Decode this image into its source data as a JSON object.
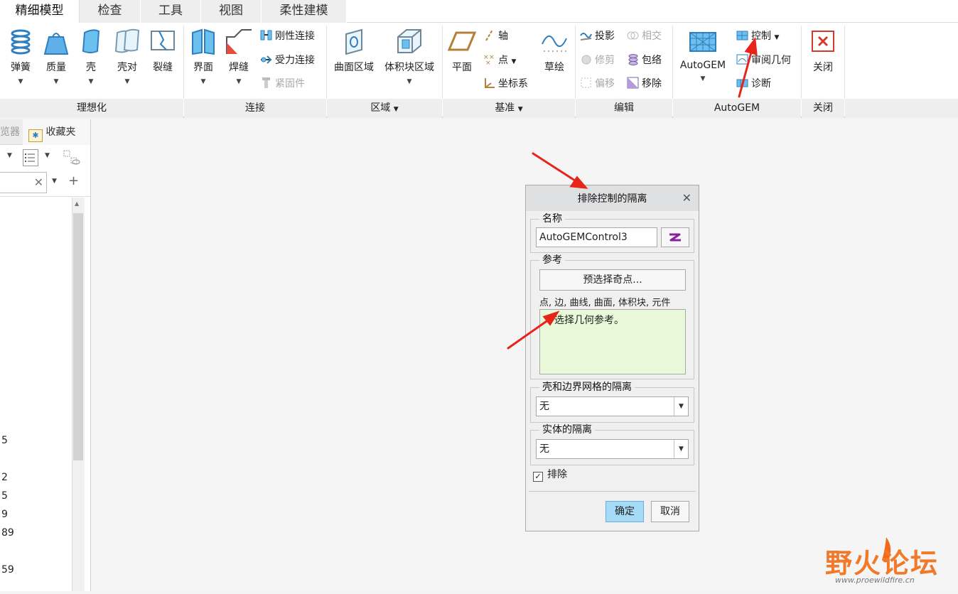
{
  "tabs": [
    "精细模型",
    "检查",
    "工具",
    "视图",
    "柔性建模"
  ],
  "ribbon": {
    "ideal": {
      "group": "理想化",
      "items": [
        "弹簧",
        "质量",
        "壳",
        "壳对",
        "裂缝"
      ]
    },
    "connect": {
      "group": "连接",
      "big": [
        "界面",
        "焊缝"
      ],
      "small": [
        "刚性连接",
        "受力连接",
        "紧固件"
      ]
    },
    "region": {
      "group": "区域",
      "items": [
        "曲面区域",
        "体积块区域"
      ]
    },
    "datum": {
      "group": "基准",
      "plane": "平面",
      "small": [
        "轴",
        "点",
        "坐标系"
      ],
      "sketch": "草绘"
    },
    "edit": {
      "group": "编辑",
      "col1": [
        "投影",
        "修剪",
        "偏移"
      ],
      "col2": [
        "相交",
        "包络",
        "移除"
      ]
    },
    "autogem": {
      "group": "AutoGEM",
      "big": "AutoGEM",
      "small": [
        "控制",
        "审阅几何",
        "诊断"
      ]
    },
    "close": {
      "group": "关闭",
      "label": "关闭"
    }
  },
  "left_panel": {
    "tabs": [
      "览器",
      "收藏夹"
    ],
    "numbers": [
      "5",
      "2",
      "5",
      "9",
      "89",
      "59"
    ]
  },
  "dialog": {
    "title": "排除控制的隔离",
    "name_legend": "名称",
    "name_value": "AutoGEMControl3",
    "ref_legend": "参考",
    "preselect_button": "预选择奇点...",
    "ref_types": "点, 边, 曲线, 曲面, 体积块, 元件",
    "ref_box_text": "选择几何参考。",
    "shell_legend": "壳和边界网格的隔离",
    "shell_value": "无",
    "solid_legend": "实体的隔离",
    "solid_value": "无",
    "exclude_label": "排除",
    "exclude_checked": true,
    "ok": "确定",
    "cancel": "取消"
  },
  "watermark": {
    "title": "野火论坛",
    "url": "www.proewildfire.cn"
  },
  "colors": {
    "accent_arrow": "#e8231a",
    "ref_box": "#e8f8d8",
    "ok_button": "#a6dbf7"
  }
}
